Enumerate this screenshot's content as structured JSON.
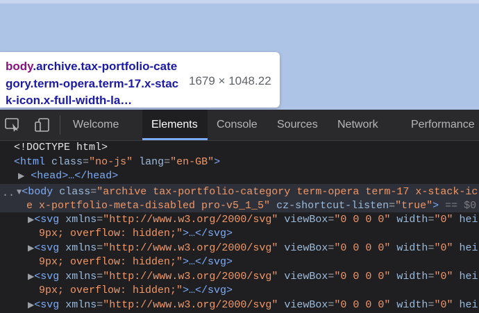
{
  "tooltip": {
    "tag": "body",
    "classes": ".archive.tax-portfolio-category.term-opera.term-17.x-stack-icon.x-full-width-la…",
    "size": "1679 × 1048.22"
  },
  "toolbar": {
    "tabs": [
      "Welcome",
      "Elements",
      "Console",
      "Sources",
      "Network",
      "Performance"
    ],
    "active_tab": "Elements"
  },
  "dom": {
    "doctype": "<!DOCTYPE html>",
    "html_open": "<html",
    "html_class_attr": "class",
    "html_class_val": "\"no-js\"",
    "html_lang_attr": "lang",
    "html_lang_val": "\"en-GB\"",
    "html_close": ">",
    "head": "<head>…</head>",
    "body_open": "<body",
    "body_class_attr": "class",
    "body_class_val_1": "\"archive tax-portfolio-category term-opera term-17 x-stack-ic",
    "body_class_val_2": "e x-portfolio-meta-disabled pro-v5_1_5\"",
    "body_shortcut_attr": "cz-shortcut-listen",
    "body_shortcut_val": "\"true\"",
    "body_close": ">",
    "body_ref": "== $0",
    "svg_tag": "<svg",
    "svg_xmlns_attr": "xmlns",
    "svg_xmlns_val": "\"http://www.w3.org/2000/svg\"",
    "svg_viewbox_attr": "viewBox",
    "svg_viewbox_val": "\"0 0 0 0\"",
    "svg_width_attr": "width",
    "svg_width_val": "\"0\"",
    "svg_height_attr": "hei",
    "svg_style_val": "9px; overflow: hidden;\"",
    "svg_close": ">…</svg>",
    "dots": ".."
  },
  "colors": {
    "page_bg": "#aec4e6",
    "devtools_bg": "#1f1f22",
    "accent": "#7cacf8",
    "tag": "#7cacf8",
    "attr_value": "#f29766"
  },
  "icons": [
    "inspect-element-icon",
    "device-toolbar-icon",
    "expand-arrow-icon",
    "collapse-arrow-icon"
  ]
}
